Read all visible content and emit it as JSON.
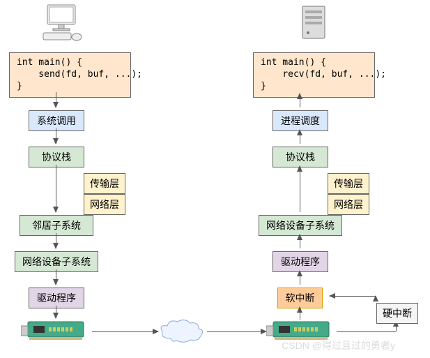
{
  "left": {
    "code": "int main() {\n    send(fd, buf, ...);\n}",
    "syscall": "系统调用",
    "protocol": "协议栈",
    "transport": "传输层",
    "network": "网络层",
    "neighbor": "邻居子系统",
    "netdev": "网络设备子系统",
    "driver": "驱动程序"
  },
  "right": {
    "code": "int main() {\n    recv(fd, buf, ...);\n}",
    "sched": "进程调度",
    "protocol": "协议栈",
    "transport": "传输层",
    "network": "网络层",
    "netdev": "网络设备子系统",
    "driver": "驱动程序",
    "softirq": "软中断",
    "hardirq": "硬中断"
  },
  "watermark": "CSDN @得过且过的勇者y"
}
